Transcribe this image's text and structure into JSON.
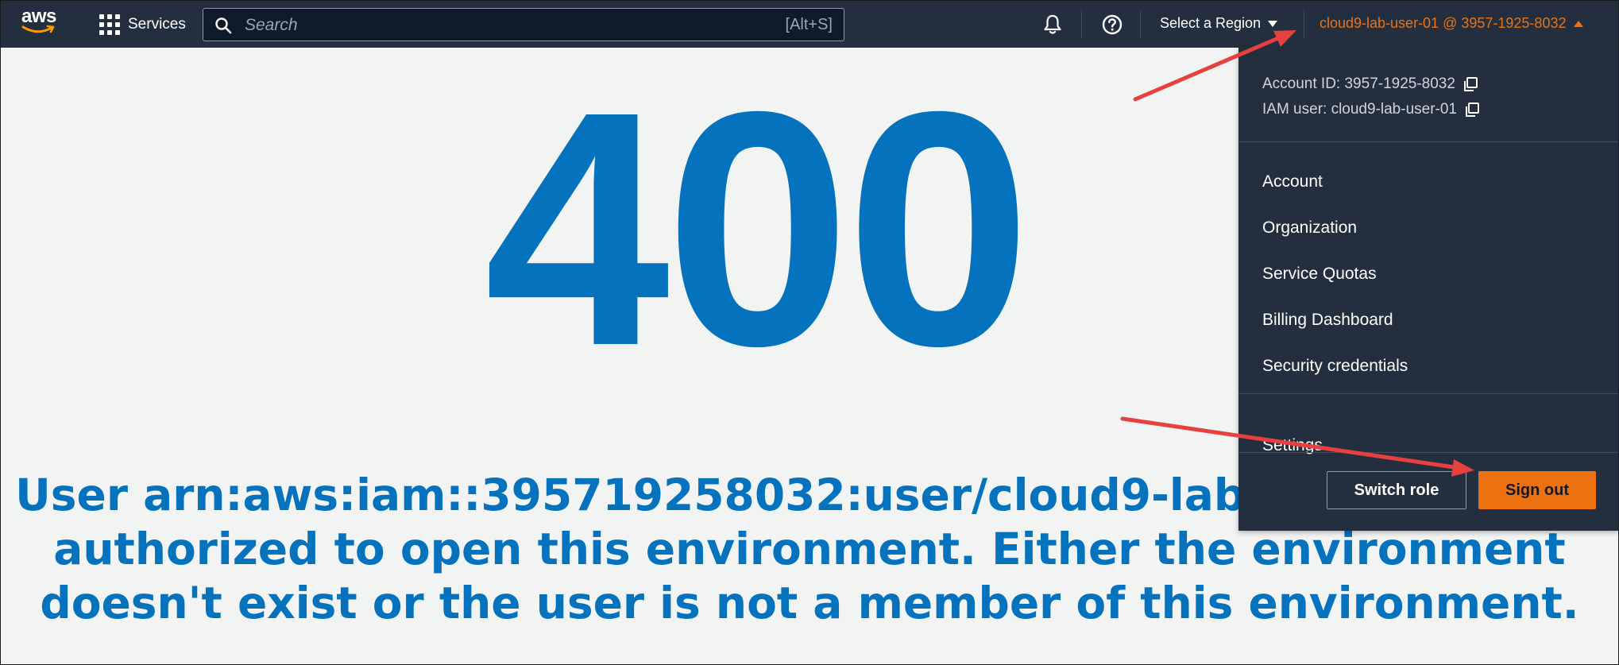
{
  "nav": {
    "logo_text": "aws",
    "services_label": "Services",
    "search": {
      "placeholder": "Search",
      "value": "",
      "shortcut": "[Alt+S]"
    },
    "region_label": "Select a Region",
    "account_label": "cloud9-lab-user-01 @ 3957-1925-8032",
    "icons": {
      "logo": "aws-logo",
      "services": "grid-icon",
      "search": "search-icon",
      "notifications": "bell-icon",
      "help": "help-icon",
      "region": "caret-down-icon",
      "account": "caret-up-icon"
    }
  },
  "main": {
    "error_code": "400",
    "error_message": "User arn:aws:iam::395719258032:user/cloud9-lab-user-01 is not authorized to open this environment. Either the environment doesn't exist or the user is not a member of this environment."
  },
  "account_dropdown": {
    "account_id": "Account ID: 3957-1925-8032",
    "iam_user": "IAM user: cloud9-lab-user-01",
    "menu_items": [
      "Account",
      "Organization",
      "Service Quotas",
      "Billing Dashboard",
      "Security credentials"
    ],
    "settings": "Settings",
    "switch_role": "Switch role",
    "sign_out": "Sign out"
  },
  "colors": {
    "nav_background": "#232f3e",
    "accent_orange": "#ec7211",
    "error_blue": "#0472bd",
    "page_background": "#f2f3f3",
    "annotation_red": "#e8403f"
  }
}
